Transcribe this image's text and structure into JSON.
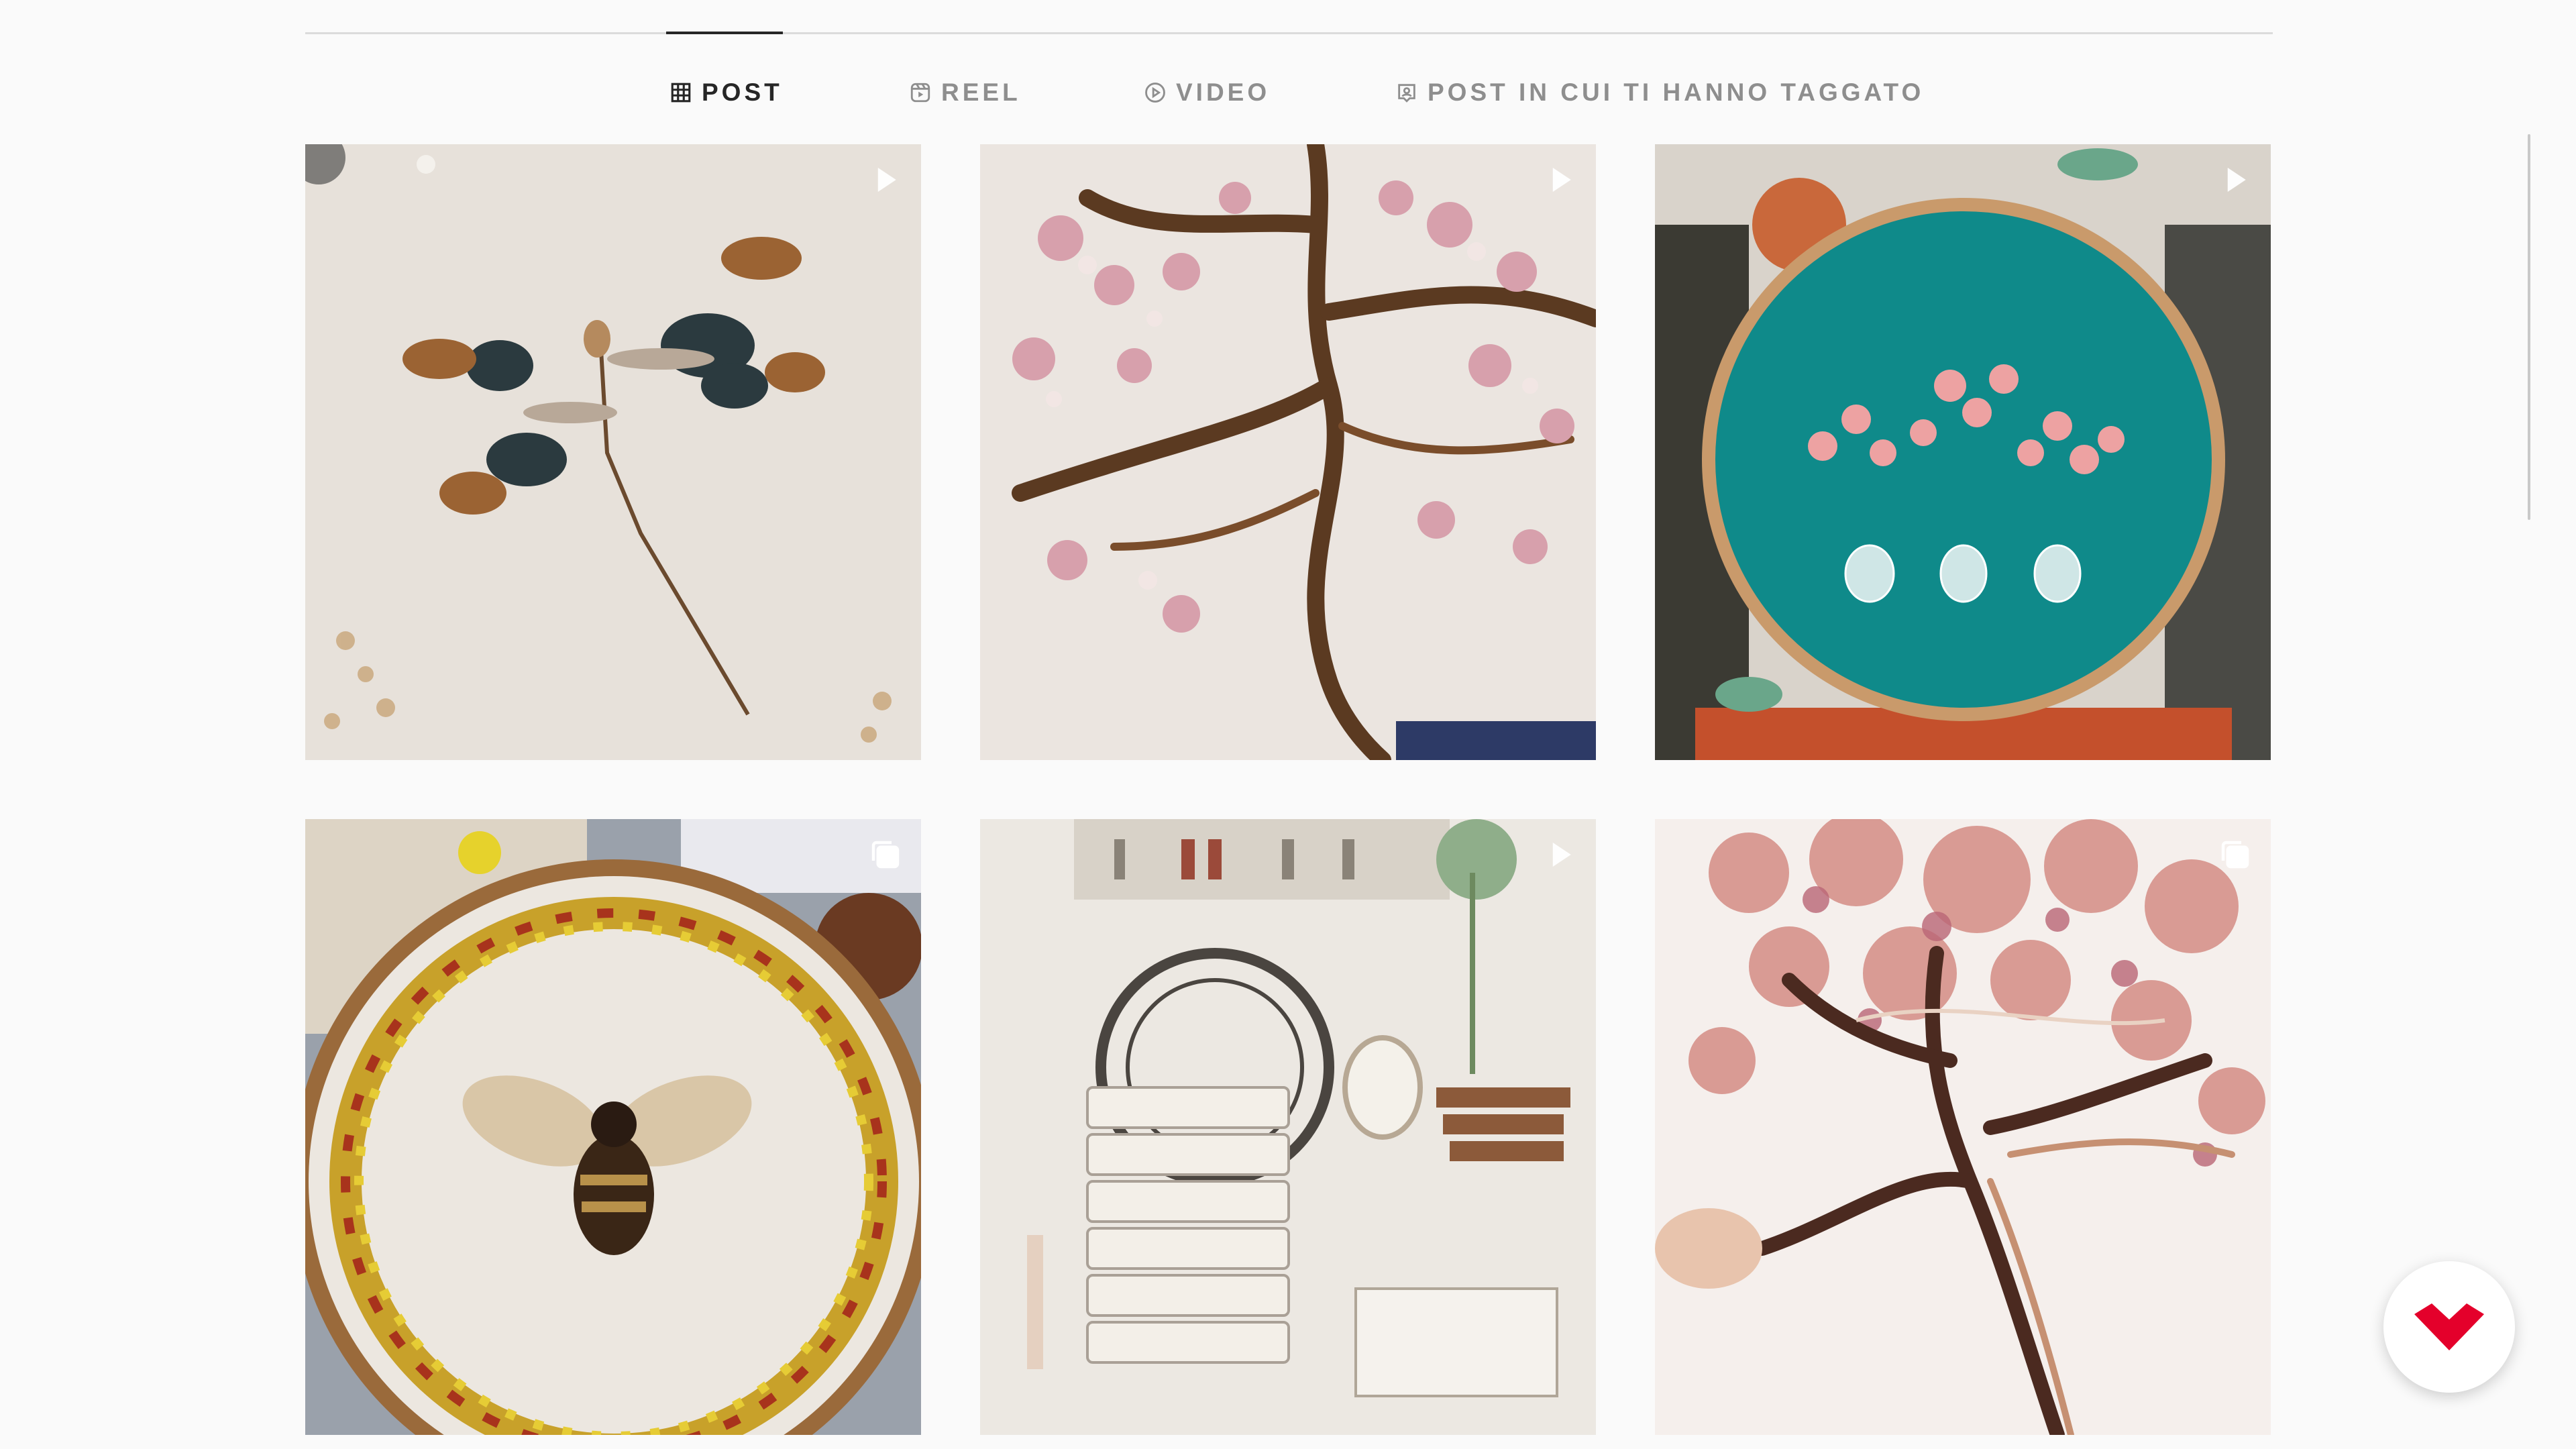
{
  "tabs": [
    {
      "label": "POST",
      "icon": "grid-icon",
      "active": true
    },
    {
      "label": "REEL",
      "icon": "reel-icon",
      "active": false
    },
    {
      "label": "VIDEO",
      "icon": "play-circle-icon",
      "active": false
    },
    {
      "label": "POST IN CUI TI HANNO TAGGATO",
      "icon": "tagged-user-icon",
      "active": false
    }
  ],
  "posts": [
    {
      "subject": "embroidered dragonfly with leaf wings",
      "badge": "reel-play-icon"
    },
    {
      "subject": "cherry blossom tree embroidery with brown cord trunk",
      "badge": "reel-play-icon"
    },
    {
      "subject": "embroidery hoop with pink berries in bottles on teal fabric",
      "badge": "reel-play-icon"
    },
    {
      "subject": "embroidered bee inside floral wreath hoop",
      "badge": "carousel-icon"
    },
    {
      "subject": "vintage craft room with clock and stacked books",
      "badge": "reel-play-icon"
    },
    {
      "subject": "pink blossom tree embroidery in progress",
      "badge": "carousel-icon"
    }
  ],
  "colors": {
    "background": "#fafafa",
    "active_tab": "#262626",
    "inactive_tab": "#8e8e8e",
    "divider": "#dbdbdb",
    "fab_accent": "#e4002b"
  },
  "fab": {
    "icon": "red-v-logo-icon"
  }
}
